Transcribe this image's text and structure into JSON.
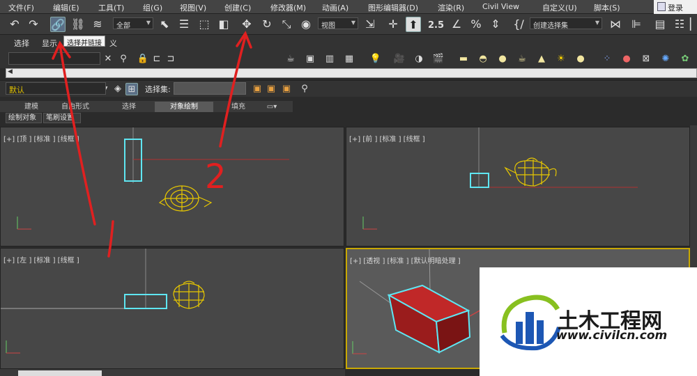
{
  "menu": {
    "items": [
      "文件(F)",
      "编辑(E)",
      "工具(T)",
      "组(G)",
      "视图(V)",
      "创建(C)",
      "修改器(M)",
      "动画(A)",
      "图形编辑器(D)",
      "渲染(R)",
      "Civil View",
      "自定义(U)",
      "脚本(S)"
    ],
    "login": "登录"
  },
  "toolbar": {
    "filter_dropdown": "全部",
    "coord_dropdown": "视图",
    "selection_set_dropdown": "创建选择集",
    "snap_label": "2.5",
    "link_tooltip": "选择并链接",
    "icons": [
      "undo-icon",
      "redo-icon",
      "select-and-link-icon",
      "unlink-icon",
      "bind-space-warp-icon",
      "select-object-icon",
      "select-by-name-icon",
      "rect-selection-icon",
      "window-crossing-icon",
      "move-icon",
      "rotate-icon",
      "scale-icon",
      "place-icon",
      "pivot-icon",
      "snap-icon",
      "angle-snap-icon",
      "percent-snap-icon",
      "spinner-snap-icon",
      "edit-named-sets-icon",
      "mirror-icon",
      "align-icon",
      "layer-explorer-icon",
      "ribbon-toggle-icon"
    ]
  },
  "ribbon_row": {
    "tabs": [
      "选择",
      "显示",
      "义"
    ]
  },
  "layer_row": {
    "layer_value": "默认",
    "selection_set_label": "选择集:"
  },
  "ribbon": {
    "tabs": [
      "建模",
      "自由形式",
      "选择",
      "对象绘制",
      "填充"
    ],
    "active_tab": "对象绘制",
    "subtabs": [
      "绘制对象",
      "笔刷设置"
    ]
  },
  "viewports": {
    "top": {
      "label": "[+] [顶 ] [标准 ] [线框 ]"
    },
    "front": {
      "label": "[+] [前 ] [标准 ] [线框 ]"
    },
    "left": {
      "label": "[+] [左 ] [标准 ] [线框 ]"
    },
    "perspective": {
      "label": "[+] [透视 ] [标准 ] [默认明暗处理 ]"
    }
  },
  "annotations": {
    "arrow_1_label": "1",
    "arrow_2_label": "2"
  },
  "watermark": {
    "title": "土木工程网",
    "url": "www.civilcn.com"
  },
  "colors": {
    "viewport_bg": "#474747",
    "active_viewport_border": "#c9a900",
    "teapot": "#e8c800",
    "box_wire": "#5fe6f2",
    "box_solid": "#b02020",
    "annotation": "#e02020",
    "logo_blue": "#1d57b4",
    "logo_green": "#88c020"
  }
}
